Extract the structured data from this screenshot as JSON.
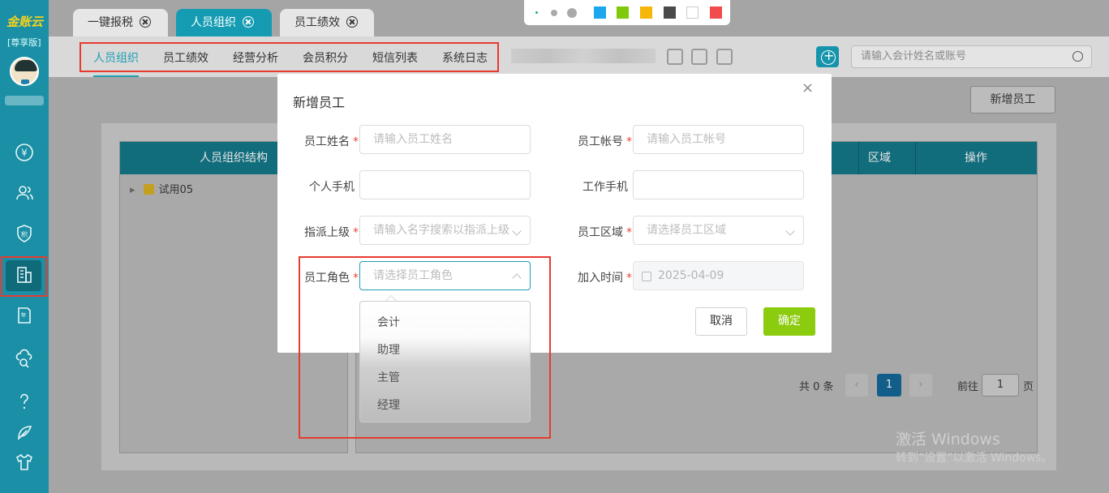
{
  "sidebar": {
    "logo": "金账云",
    "edition": "[尊享版]",
    "icons": [
      "yuan-circle-icon",
      "users-icon",
      "shield-积-icon",
      "building-icon",
      "annual-report-icon",
      "cloud-search-icon",
      "question-icon",
      "feather-icon",
      "tshirt-icon"
    ]
  },
  "tabs": [
    {
      "label": "一键报税",
      "active": false
    },
    {
      "label": "人员组织",
      "active": true
    },
    {
      "label": "员工绩效",
      "active": false
    }
  ],
  "palette": {
    "colors": [
      "#1da7ef",
      "#7fc90a",
      "#f6b60a",
      "#4a4a4a",
      "#ffffff",
      "#f24b4b"
    ]
  },
  "subnav": {
    "items": [
      "人员组织",
      "员工绩效",
      "经营分析",
      "会员积分",
      "短信列表",
      "系统日志"
    ],
    "active": "人员组织"
  },
  "search": {
    "placeholder": "请输入会计姓名或账号"
  },
  "page": {
    "new_employee_button": "新增员工",
    "tree_header": "人员组织结构",
    "tree_item": "试用05",
    "table_headers": {
      "region": "区域",
      "action": "操作"
    },
    "pager": {
      "total": "共 0 条",
      "prev": "‹",
      "current": "1",
      "next": "›",
      "goto_label": "前往",
      "goto_value": "1",
      "page_unit": "页"
    }
  },
  "watermark": {
    "line1": "激活 Windows",
    "line2": "转到“设置”以激活 Windows。"
  },
  "modal": {
    "title": "新增员工",
    "close": "×",
    "fields": {
      "name": {
        "label": "员工姓名",
        "placeholder": "请输入员工姓名"
      },
      "account": {
        "label": "员工帐号",
        "placeholder": "请输入员工帐号"
      },
      "personal_phone": {
        "label": "个人手机",
        "value": ""
      },
      "work_phone": {
        "label": "工作手机",
        "value": ""
      },
      "superior": {
        "label": "指派上级",
        "placeholder": "请输入名字搜索以指派上级"
      },
      "region": {
        "label": "员工区域",
        "placeholder": "请选择员工区域"
      },
      "role": {
        "label": "员工角色",
        "placeholder": "请选择员工角色"
      },
      "join_date": {
        "label": "加入时间",
        "value": "2025-04-09"
      }
    },
    "cancel": "取消",
    "confirm": "确定"
  },
  "role_dropdown": {
    "options": [
      "会计",
      "助理",
      "主管",
      "经理"
    ]
  }
}
